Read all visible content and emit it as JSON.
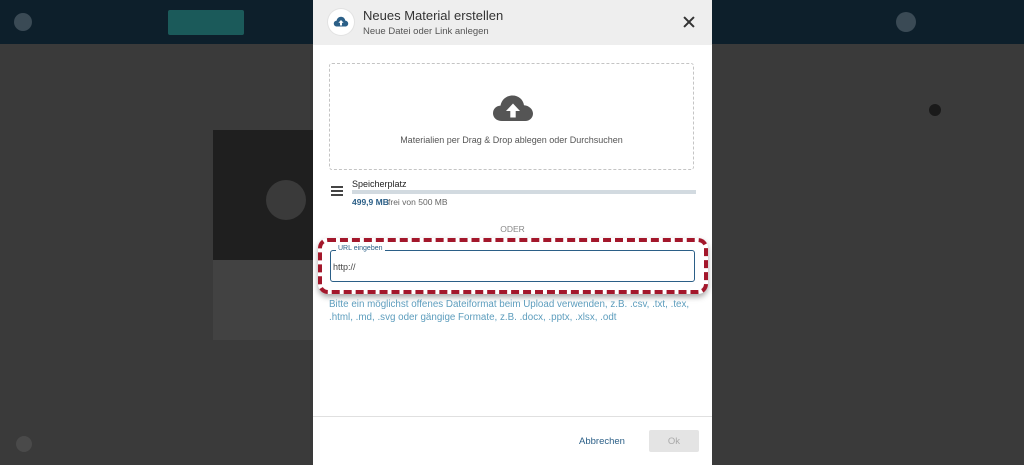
{
  "colors": {
    "primary": "#2b5f87",
    "hint_text": "#5d9dbd",
    "highlight": "#a3172b",
    "overlay": "#2f2f2f"
  },
  "dialog": {
    "title": "Neues Material erstellen",
    "subtitle": "Neue Datei oder Link anlegen",
    "header_icon": "cloud-upload-icon",
    "close_icon": "close-icon"
  },
  "dropzone": {
    "icon": "cloud-upload-icon",
    "text": "Materialien per Drag & Drop ablegen oder Durchsuchen"
  },
  "storage": {
    "icon": "storage-icon",
    "title": "Speicherplatz",
    "used": "499,9 MB",
    "total": "frei von 500 MB",
    "free_fraction": 0.9998
  },
  "separator": "ODER",
  "url_field": {
    "label": "URL eingeben",
    "value": "http://"
  },
  "hint": "Bitte ein möglichst offenes Dateiformat beim Upload verwenden, z.B. .csv, .txt, .tex, .html, .md, .svg oder gängige Formate, z.B. .docx, .pptx, .xlsx, .odt",
  "buttons": {
    "cancel": "Abbrechen",
    "ok": "Ok"
  }
}
